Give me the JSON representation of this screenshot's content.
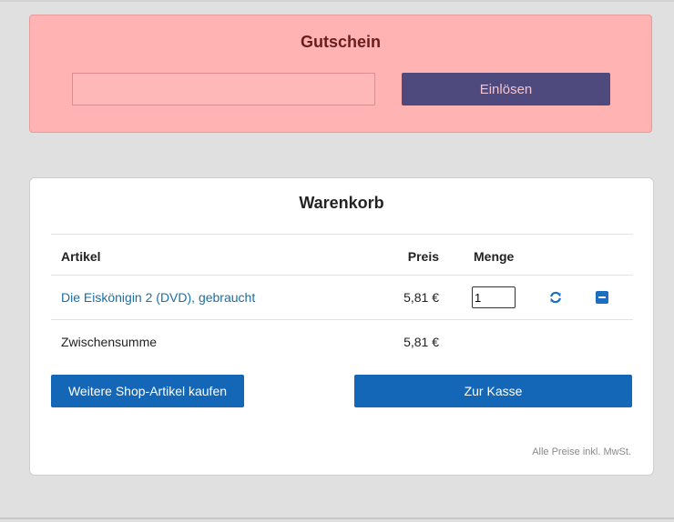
{
  "voucher": {
    "title": "Gutschein",
    "input_value": "",
    "input_placeholder": "",
    "button_label": "Einlösen"
  },
  "cart": {
    "title": "Warenkorb",
    "headers": {
      "article": "Artikel",
      "price": "Preis",
      "quantity": "Menge"
    },
    "items": [
      {
        "name": "Die Eiskönigin 2 (DVD), gebraucht",
        "price": "5,81 €",
        "quantity": "1"
      }
    ],
    "subtotal": {
      "label": "Zwischensumme",
      "value": "5,81 €"
    },
    "continue_button": "Weitere Shop-Artikel kaufen",
    "checkout_button": "Zur Kasse",
    "note": "Alle Preise inkl. MwSt."
  },
  "icons": {
    "update": "refresh-icon",
    "remove": "minus-square-icon"
  },
  "colors": {
    "accent": "#1467b6",
    "voucher_bg": "#ffb3b3",
    "voucher_button": "#4f4a7e",
    "link": "#1a6fa8"
  }
}
